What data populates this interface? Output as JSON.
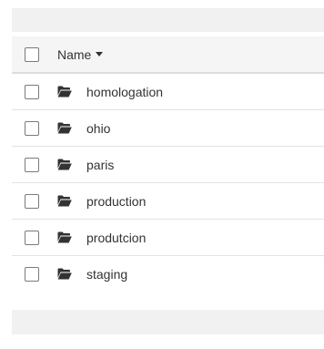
{
  "table": {
    "header": {
      "name_label": "Name",
      "sort_icon": "caret-down-icon"
    },
    "rows": [
      {
        "name": "homologation",
        "icon": "folder-open-icon"
      },
      {
        "name": "ohio",
        "icon": "folder-open-icon"
      },
      {
        "name": "paris",
        "icon": "folder-open-icon"
      },
      {
        "name": "production",
        "icon": "folder-open-icon"
      },
      {
        "name": "produtcion",
        "icon": "folder-open-icon"
      },
      {
        "name": "staging",
        "icon": "folder-open-icon"
      }
    ]
  },
  "colors": {
    "bar_background": "#f1f1f1",
    "header_background": "#f5f5f5",
    "text": "#333333"
  }
}
